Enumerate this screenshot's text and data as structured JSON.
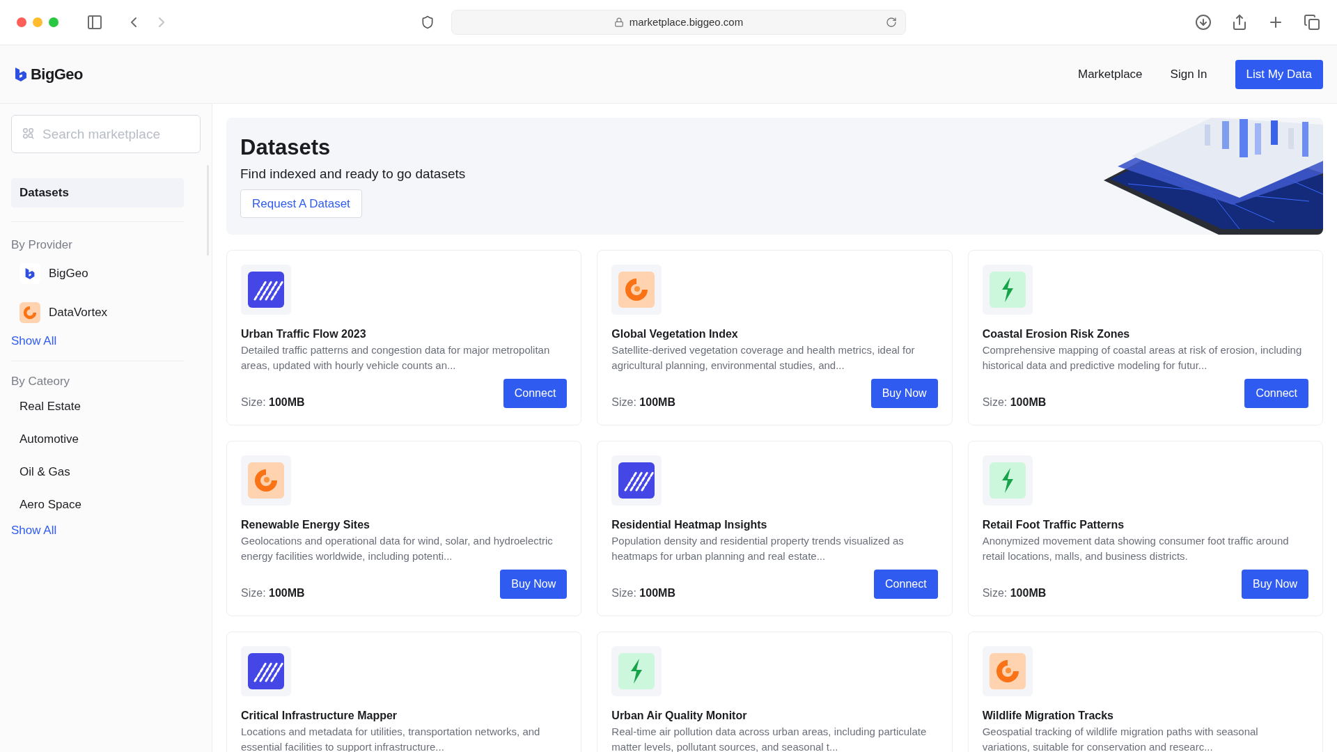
{
  "browser": {
    "url": "marketplace.biggeo.com"
  },
  "header": {
    "logo": "BigGeo",
    "nav": [
      "Marketplace",
      "Sign In"
    ],
    "cta": "List My Data"
  },
  "sidebar": {
    "search": {
      "placeholder": "Search marketplace"
    },
    "items": [
      {
        "label": "Datasets",
        "selected": true
      }
    ],
    "providers": {
      "title": "By Provider",
      "items": [
        {
          "label": "BigGeo",
          "kind": "biggeo"
        },
        {
          "label": "DataVortex",
          "kind": "vortex"
        }
      ],
      "more": "Show All"
    },
    "categories": {
      "title": "By Cateory",
      "items": [
        "Real Estate",
        "Automotive",
        "Oil & Gas",
        "Aero Space"
      ],
      "more": "Show All"
    }
  },
  "hero": {
    "title": "Datasets",
    "subtitle": "Find indexed and ready to go datasets",
    "button": "Request A Dataset"
  },
  "cards": [
    {
      "kind": "stripes",
      "title": "Urban Traffic Flow 2023",
      "description": "Detailed traffic patterns and congestion data for major metropolitan areas, updated with hourly vehicle counts an...",
      "size_label": "Size:",
      "size": "100MB",
      "action": "Connect"
    },
    {
      "kind": "vortex",
      "title": "Global Vegetation Index",
      "description": "Satellite-derived vegetation coverage and health metrics, ideal for agricultural planning, environmental studies, and...",
      "size_label": "Size:",
      "size": "100MB",
      "action": "Buy Now"
    },
    {
      "kind": "bolt",
      "title": "Coastal Erosion Risk Zones",
      "description": "Comprehensive mapping of coastal areas at risk of erosion, including historical data and predictive modeling for futur...",
      "size_label": "Size:",
      "size": "100MB",
      "action": "Connect"
    },
    {
      "kind": "vortex",
      "title": "Renewable Energy Sites",
      "description": "Geolocations and operational data for wind, solar, and hydroelectric energy facilities worldwide, including potenti...",
      "size_label": "Size:",
      "size": "100MB",
      "action": "Buy Now"
    },
    {
      "kind": "stripes",
      "title": "Residential Heatmap Insights",
      "description": "Population density and residential property trends visualized as heatmaps for urban planning and real estate...",
      "size_label": "Size:",
      "size": "100MB",
      "action": "Connect"
    },
    {
      "kind": "bolt",
      "title": "Retail Foot Traffic Patterns",
      "description": "Anonymized movement data showing consumer foot traffic around retail locations, malls, and business districts.",
      "size_label": "Size:",
      "size": "100MB",
      "action": "Buy Now"
    },
    {
      "kind": "stripes",
      "title": "Critical Infrastructure Mapper",
      "description": "Locations and metadata for utilities, transportation networks, and essential facilities to support infrastructure..."
    },
    {
      "kind": "bolt",
      "title": "Urban Air Quality Monitor",
      "description": "Real-time air pollution data across urban areas, including particulate matter levels, pollutant sources, and seasonal t..."
    },
    {
      "kind": "vortex",
      "title": "Wildlife Migration Tracks",
      "description": "Geospatial tracking of wildlife migration paths with seasonal variations, suitable for conservation and researc..."
    }
  ]
}
